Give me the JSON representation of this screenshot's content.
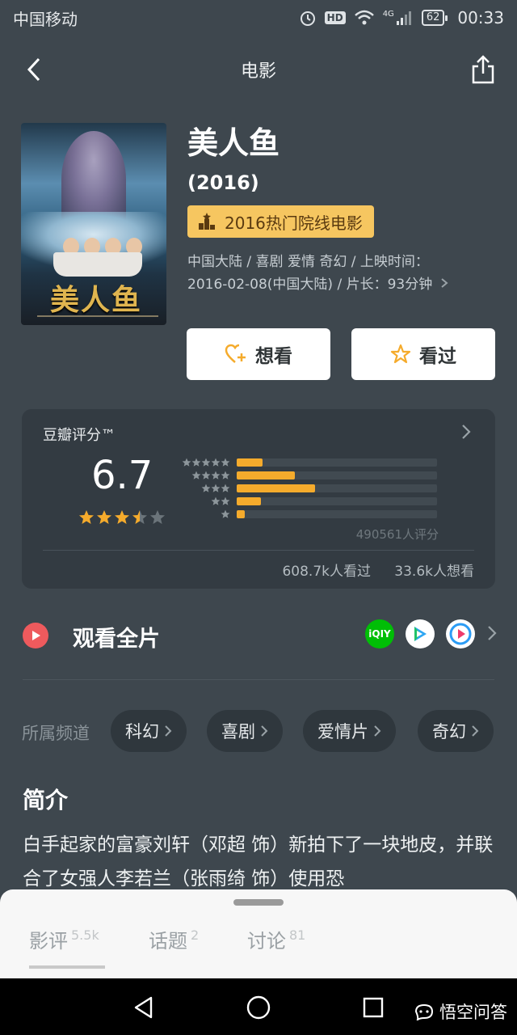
{
  "status_bar": {
    "carrier": "中国移动",
    "network": "4G",
    "hd": "HD",
    "battery": "62",
    "time": "00:33"
  },
  "nav": {
    "title": "电影"
  },
  "movie": {
    "title": "美人鱼",
    "year": "(2016)",
    "award": "2016热门院线电影",
    "meta_line1": "中国大陆 / 喜剧 爱情 奇幻 / 上映时间：",
    "meta_line2": "2016-02-08(中国大陆) / 片长：93分钟",
    "poster_title": "美人鱼"
  },
  "actions": {
    "want_label": "想看",
    "seen_label": "看过"
  },
  "rating": {
    "label": "豆瓣评分™",
    "score": "6.7",
    "star_value": 3.5,
    "distribution": [
      {
        "stars": 5,
        "fraction": 0.13
      },
      {
        "stars": 4,
        "fraction": 0.29
      },
      {
        "stars": 3,
        "fraction": 0.39
      },
      {
        "stars": 2,
        "fraction": 0.12
      },
      {
        "stars": 1,
        "fraction": 0.04
      }
    ],
    "count_text": "490561人评分",
    "seen_text": "608.7k人看过",
    "want_text": "33.6k人想看"
  },
  "watch": {
    "label": "观看全片",
    "platforms": [
      {
        "name": "iqiyi",
        "text": "iQIY",
        "color": "#00be06"
      },
      {
        "name": "tencent-video",
        "text": "▶",
        "color": "#ffffff"
      },
      {
        "name": "youku",
        "text": "▶",
        "color": "#ffffff"
      }
    ]
  },
  "channels": {
    "label": "所属频道",
    "items": [
      "科幻",
      "喜剧",
      "爱情片",
      "奇幻"
    ]
  },
  "intro": {
    "title": "简介",
    "text": "白手起家的富豪刘轩（邓超 饰）新拍下了一块地皮，并联合了女强人李若兰（张雨绮 饰）使用恐"
  },
  "tabs": [
    {
      "label": "影评",
      "count": "5.5k"
    },
    {
      "label": "话题",
      "count": "2"
    },
    {
      "label": "讨论",
      "count": "81"
    }
  ],
  "watermark": {
    "text": "悟空问答"
  },
  "colors": {
    "background": "#3e474e",
    "accent": "#f5ab2c",
    "badge": "#f6c660",
    "play": "#ee5a5d"
  }
}
